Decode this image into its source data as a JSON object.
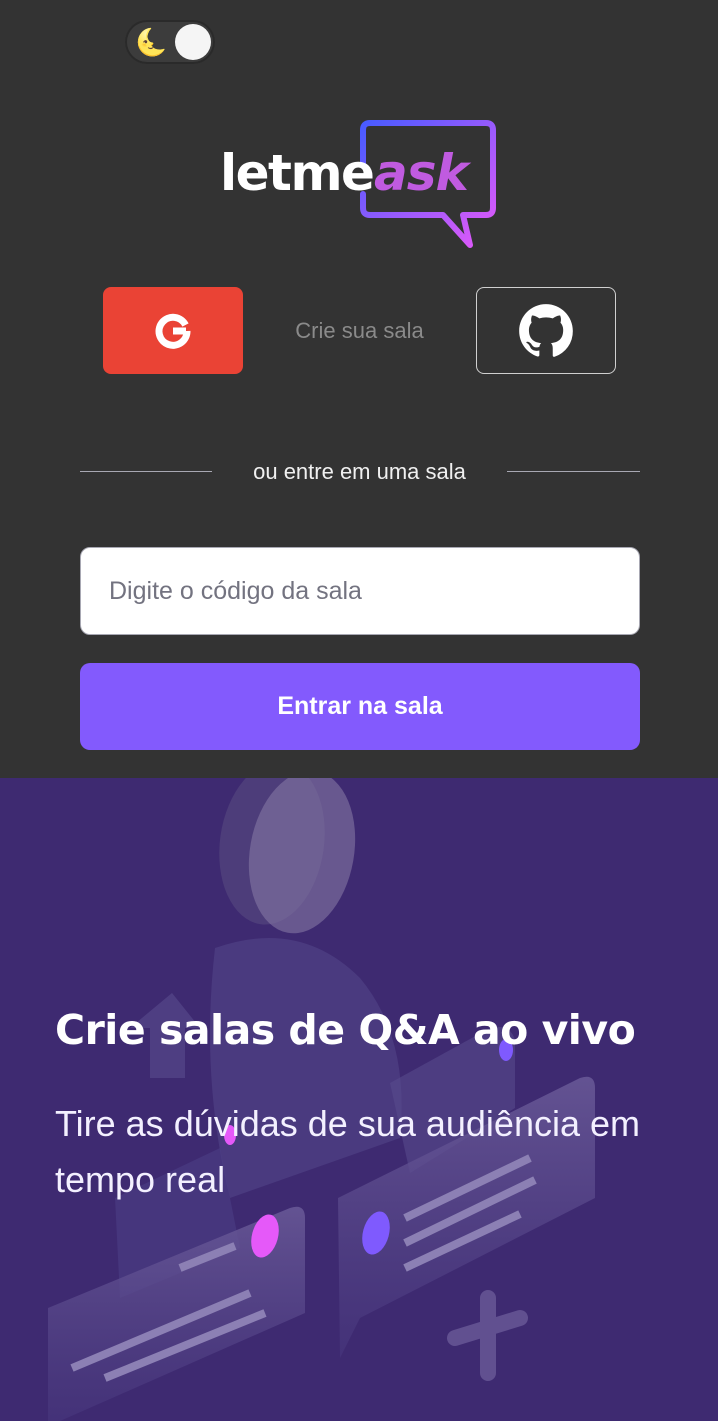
{
  "theme_toggle": {
    "icon": "moon-icon",
    "glyph": "🌜",
    "dark_mode": true
  },
  "logo": {
    "part1": "letme",
    "part2": "ask"
  },
  "auth": {
    "google_icon": "google-icon",
    "github_icon": "github-icon",
    "create_room_label": "Crie sua sala"
  },
  "join": {
    "divider_text": "ou entre em uma sala",
    "input_placeholder": "Digite o código da sala",
    "input_value": "",
    "submit_label": "Entrar na sala"
  },
  "hero": {
    "title": "Crie salas de Q&A ao vivo",
    "subtitle": "Tire as dúvidas de sua audiência em tempo real"
  },
  "colors": {
    "background": "#333333",
    "google": "#ea4335",
    "accent": "#835afd",
    "hero_bg": "#3e2a71"
  }
}
